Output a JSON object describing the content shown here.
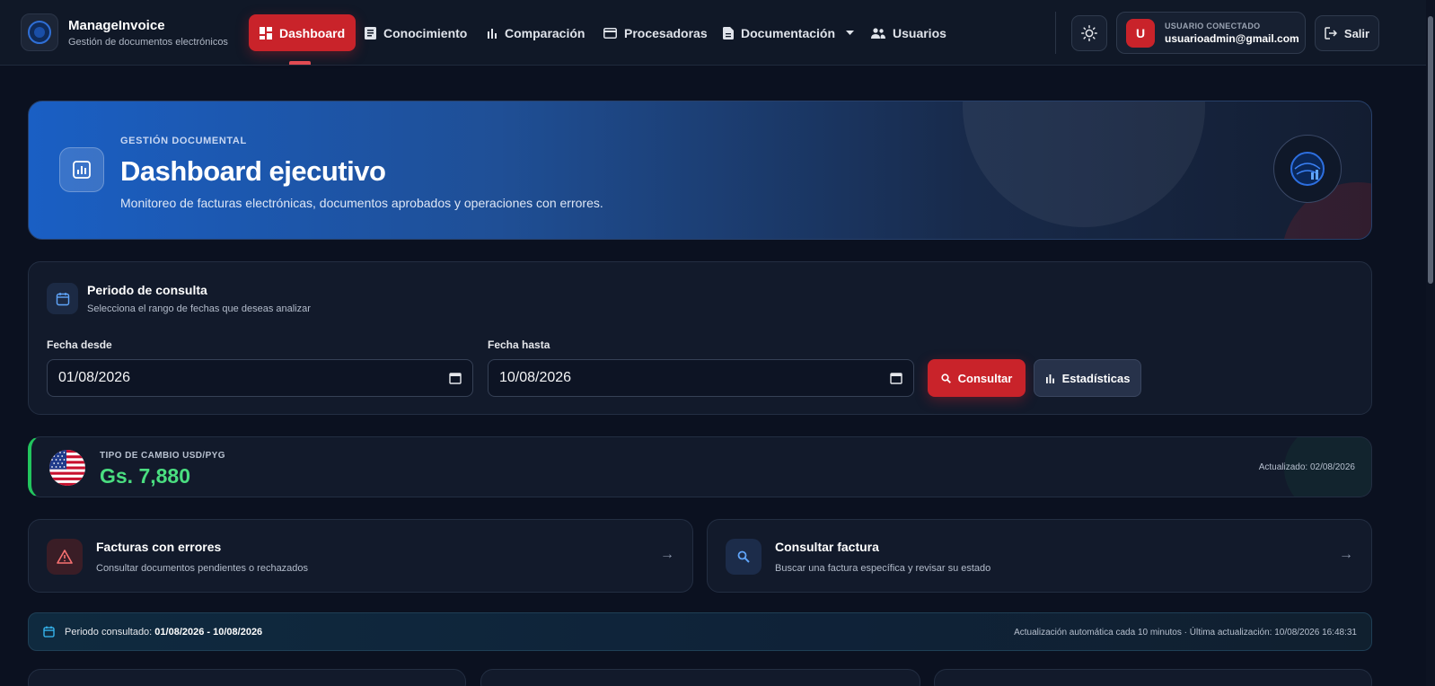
{
  "brand": {
    "name": "ManageInvoice",
    "subtitle": "Gestión de documentos electrónicos"
  },
  "nav": {
    "items": [
      {
        "label": "Dashboard",
        "icon": "dashboard-icon",
        "active": true
      },
      {
        "label": "Conocimiento",
        "icon": "document-icon"
      },
      {
        "label": "Comparación",
        "icon": "bar-chart-icon"
      },
      {
        "label": "Procesadoras",
        "icon": "credit-card-icon"
      },
      {
        "label": "Documentación",
        "icon": "file-icon",
        "dropdown": true
      },
      {
        "label": "Usuarios",
        "icon": "users-icon"
      }
    ]
  },
  "user": {
    "avatar_letter": "U",
    "caption": "USUARIO CONECTADO",
    "email": "usuarioadmin@gmail.com"
  },
  "logout_label": "Salir",
  "hero": {
    "kicker": "GESTIÓN DOCUMENTAL",
    "title": "Dashboard ejecutivo",
    "subtitle": "Monitoreo de facturas electrónicas, documentos aprobados y operaciones con errores."
  },
  "period": {
    "title": "Periodo de consulta",
    "subtitle": "Selecciona el rango de fechas que deseas analizar",
    "from_label": "Fecha desde",
    "from_value": "01/08/2026",
    "to_label": "Fecha hasta",
    "to_value": "10/08/2026",
    "consult_label": "Consultar",
    "stats_label": "Estadísticas"
  },
  "exchange": {
    "label": "TIPO DE CAMBIO USD/PYG",
    "value": "Gs. 7,880",
    "updated": "Actualizado: 02/08/2026"
  },
  "quick_actions": [
    {
      "title": "Facturas con errores",
      "subtitle": "Consultar documentos pendientes o rechazados",
      "icon": "warning-icon"
    },
    {
      "title": "Consultar factura",
      "subtitle": "Buscar una factura específica y revisar su estado",
      "icon": "search-icon"
    }
  ],
  "info_strip": {
    "prefix": "Periodo consultado:",
    "range": "01/08/2026 - 10/08/2026",
    "right": "Actualización automática cada 10 minutos · Última actualización: 10/08/2026 16:48:31"
  },
  "colors": {
    "accent_red": "#c9232a",
    "success_green": "#4ade80",
    "hero_blue": "#1a5fc4",
    "background": "#0b1120"
  },
  "qa_arrow": "→"
}
